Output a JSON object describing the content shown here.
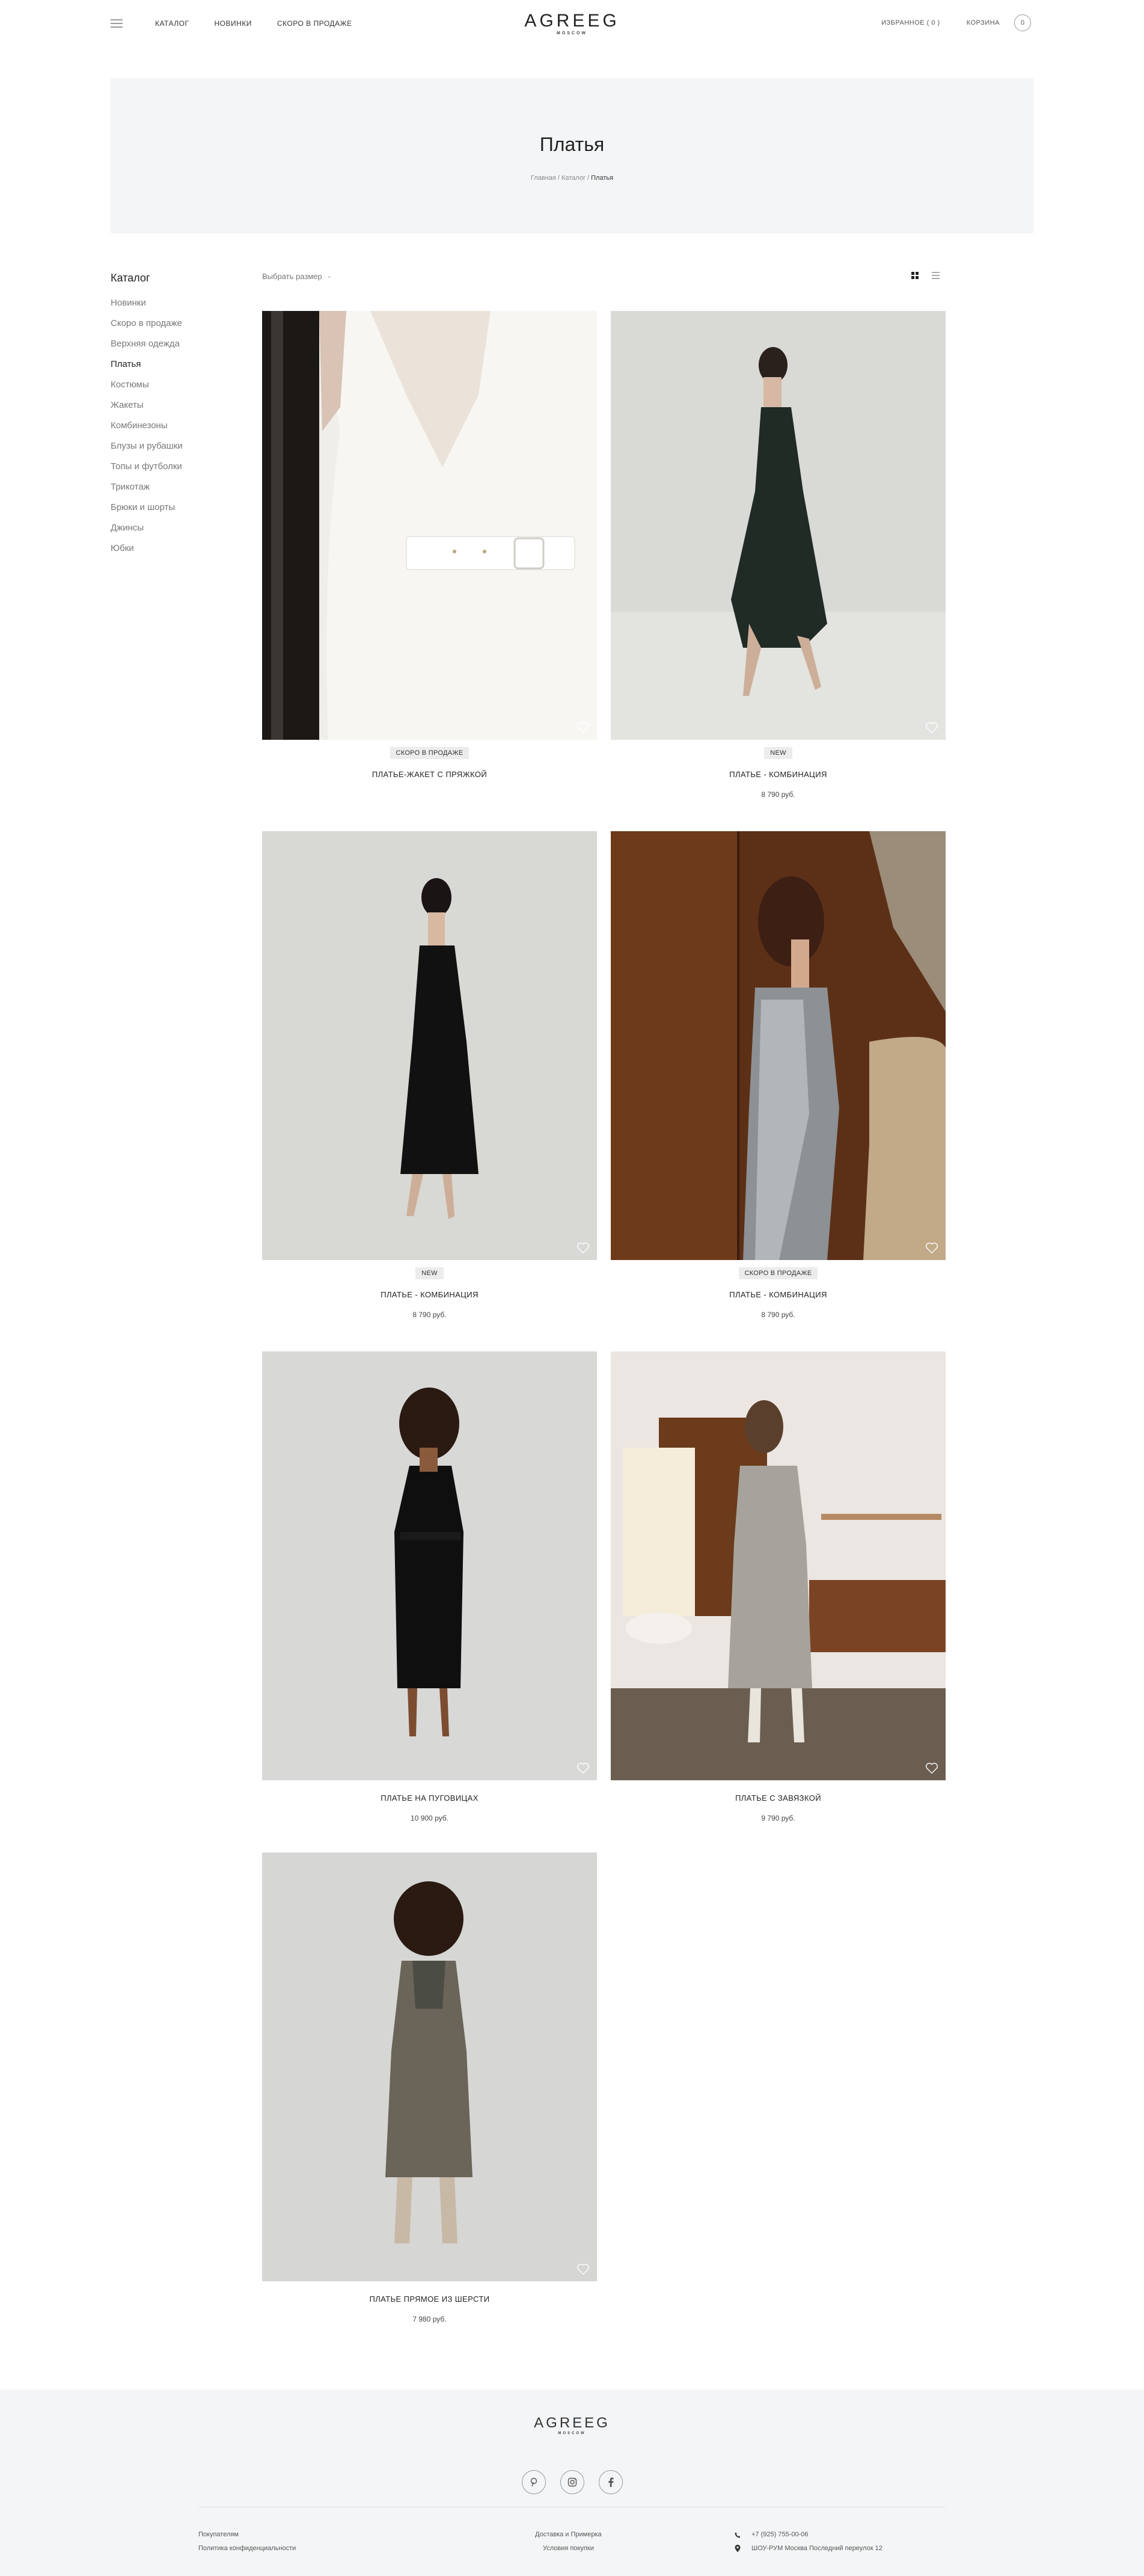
{
  "header": {
    "nav": [
      "КАТАЛОГ",
      "НОВИНКИ",
      "СКОРО В ПРОДАЖЕ"
    ],
    "logo": "AGREEG",
    "logo_sub": "MOSCOW",
    "favorites": "ИЗБРАННОЕ ( 0 )",
    "cart_label": "КОРЗИНА",
    "cart_count": "0"
  },
  "hero": {
    "title": "Платья",
    "breadcrumb": [
      "Главная",
      "Каталог",
      "Платья"
    ]
  },
  "sidebar": {
    "title": "Каталог",
    "items": [
      "Новинки",
      "Скоро в продаже",
      "Верхняя одежда",
      "Платья",
      "Костюмы",
      "Жакеты",
      "Комбинезоны",
      "Блузы и рубашки",
      "Топы и футболки",
      "Трикотаж",
      "Брюки и шорты",
      "Джинсы",
      "Юбки"
    ],
    "active": "Платья"
  },
  "filters": {
    "size_select": "Выбрать размер"
  },
  "products": [
    {
      "badge": "СКОРО В ПРОДАЖЕ",
      "name": "ПЛАТЬЕ-ЖАКЕТ С ПРЯЖКОЙ",
      "price": ""
    },
    {
      "badge": "NEW",
      "name": "ПЛАТЬЕ - КОМБИНАЦИЯ",
      "price": "8 790 руб."
    },
    {
      "badge": "NEW",
      "name": "ПЛАТЬЕ - КОМБИНАЦИЯ",
      "price": "8 790 руб."
    },
    {
      "badge": "СКОРО В ПРОДАЖЕ",
      "name": "ПЛАТЬЕ - КОМБИНАЦИЯ",
      "price": "8 790 руб."
    },
    {
      "badge": "",
      "name": "ПЛАТЬЕ НА ПУГОВИЦАХ",
      "price": "10 900 руб."
    },
    {
      "badge": "",
      "name": "ПЛАТЬЕ С ЗАВЯЗКОЙ",
      "price": "9 790 руб."
    },
    {
      "badge": "",
      "name": "ПЛАТЬЕ ПРЯМОЕ ИЗ ШЕРСТИ",
      "price": "7 980 руб."
    }
  ],
  "footer": {
    "logo": "AGREEG",
    "logo_sub": "MOSCOW",
    "col1": [
      "Покупателям",
      "Политика конфиденциальности"
    ],
    "col2": [
      "Доставка и Примерка",
      "Условия покупки"
    ],
    "phone": "+7 (925) 755-00-06",
    "address": "ШОУ-РУМ Москва Последний переулок 12"
  },
  "icons": {
    "menu": "burger-menu-icon",
    "grid": "grid-view-icon",
    "list": "list-view-icon",
    "heart": "heart-icon",
    "pinterest": "pinterest-icon",
    "instagram": "instagram-icon",
    "facebook": "facebook-icon",
    "phone": "phone-icon",
    "location": "location-pin-icon"
  }
}
